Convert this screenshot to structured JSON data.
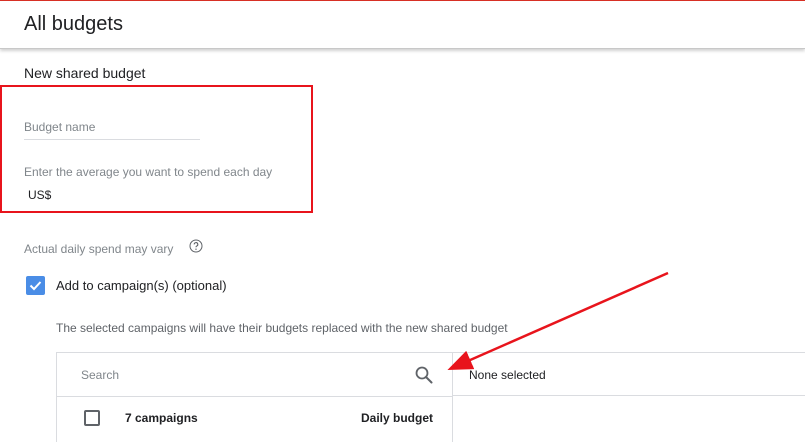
{
  "header": {
    "title": "All budgets"
  },
  "form": {
    "section_title": "New shared budget",
    "budget_name_placeholder": "Budget name",
    "average_label": "Enter the average you want to spend each day",
    "currency": "US$",
    "spend_note": "Actual daily spend may vary",
    "add_to_campaigns_label": "Add to campaign(s) (optional)",
    "add_to_campaigns_checked": true,
    "replace_note": "The selected campaigns will have their budgets replaced with the new shared budget"
  },
  "campaign_picker": {
    "search_placeholder": "Search",
    "columns": {
      "name": "7 campaigns",
      "budget": "Daily budget"
    },
    "selected_text": "None selected"
  },
  "icons": {
    "help": "help-circle-icon",
    "search": "search-icon",
    "checkbox_checked": "check-icon"
  },
  "colors": {
    "accent": "#4a8de6",
    "annotation": "#e8141c",
    "top_bar": "#d93025"
  }
}
